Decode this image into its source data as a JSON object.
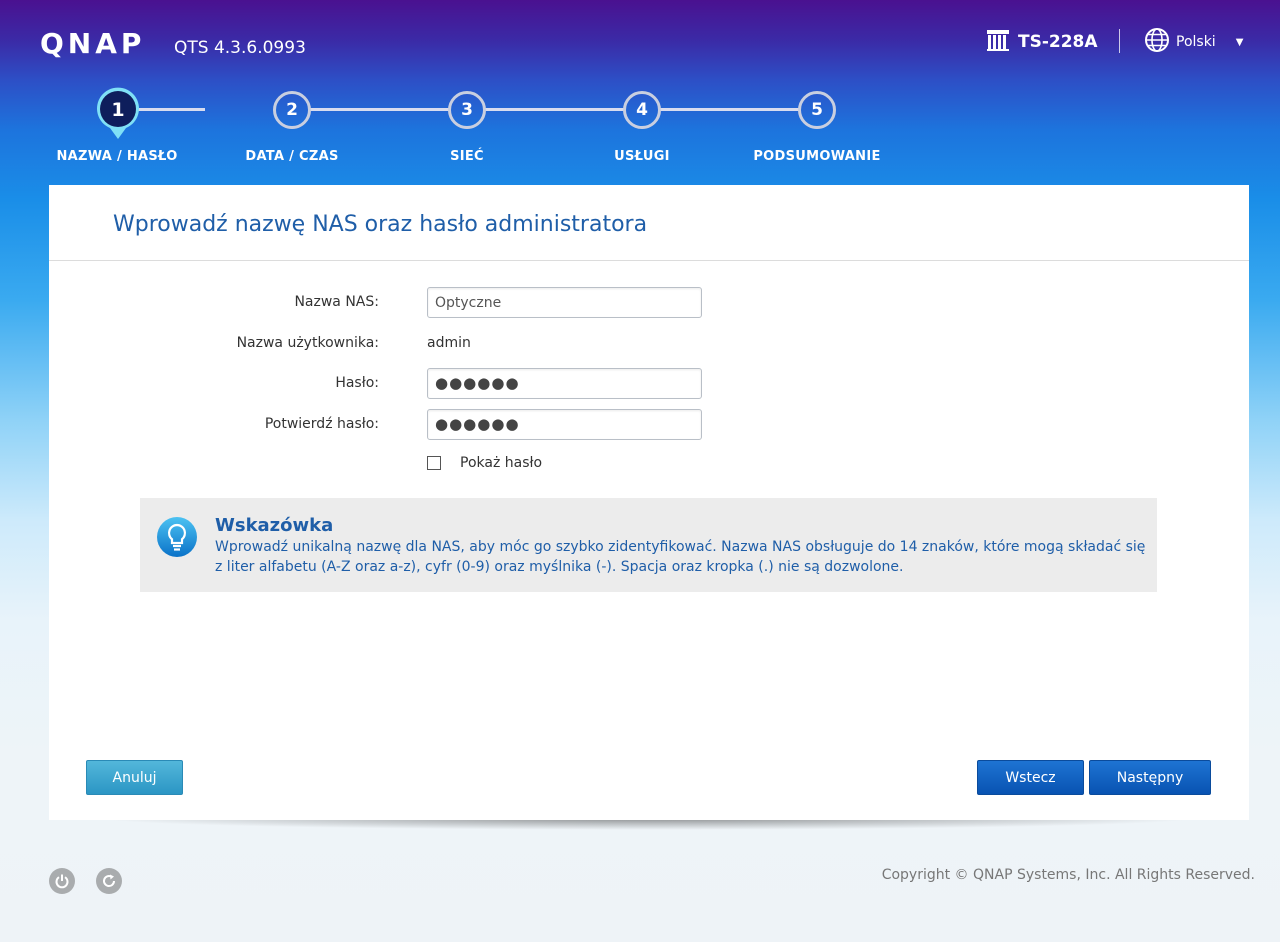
{
  "header": {
    "logo": "QNAP",
    "version": "QTS 4.3.6.0993",
    "model": "TS-228A",
    "language": "Polski"
  },
  "steps": [
    {
      "number": "1",
      "label": "NAZWA / HASŁO",
      "active": true
    },
    {
      "number": "2",
      "label": "DATA / CZAS",
      "active": false
    },
    {
      "number": "3",
      "label": "SIEĆ",
      "active": false
    },
    {
      "number": "4",
      "label": "USŁUGI",
      "active": false
    },
    {
      "number": "5",
      "label": "PODSUMOWANIE",
      "active": false
    }
  ],
  "panel": {
    "title": "Wprowadź nazwę NAS oraz hasło administratora",
    "form": {
      "nas_name_label": "Nazwa NAS:",
      "nas_name_value": "Optyczne",
      "username_label": "Nazwa użytkownika:",
      "username_value": "admin",
      "password_label": "Hasło:",
      "password_value": "●●●●●●",
      "confirm_label": "Potwierdź hasło:",
      "confirm_value": "●●●●●●",
      "show_password_label": "Pokaż hasło",
      "show_password_checked": false
    },
    "tip": {
      "title": "Wskazówka",
      "text": "Wprowadź unikalną nazwę dla NAS, aby móc go szybko zidentyfikować. Nazwa NAS obsługuje do 14 znaków, które mogą składać się z liter alfabetu (A-Z oraz a-z), cyfr (0-9) oraz myślnika (-). Spacja oraz kropka (.) nie są dozwolone."
    },
    "buttons": {
      "cancel": "Anuluj",
      "back": "Wstecz",
      "next": "Następny"
    }
  },
  "footer": {
    "copyright": "Copyright © QNAP Systems, Inc. All Rights Reserved."
  },
  "colors": {
    "accent_blue": "#1f5ea8",
    "button_primary": "#0b5cbf",
    "button_secondary": "#3ca6cf"
  }
}
